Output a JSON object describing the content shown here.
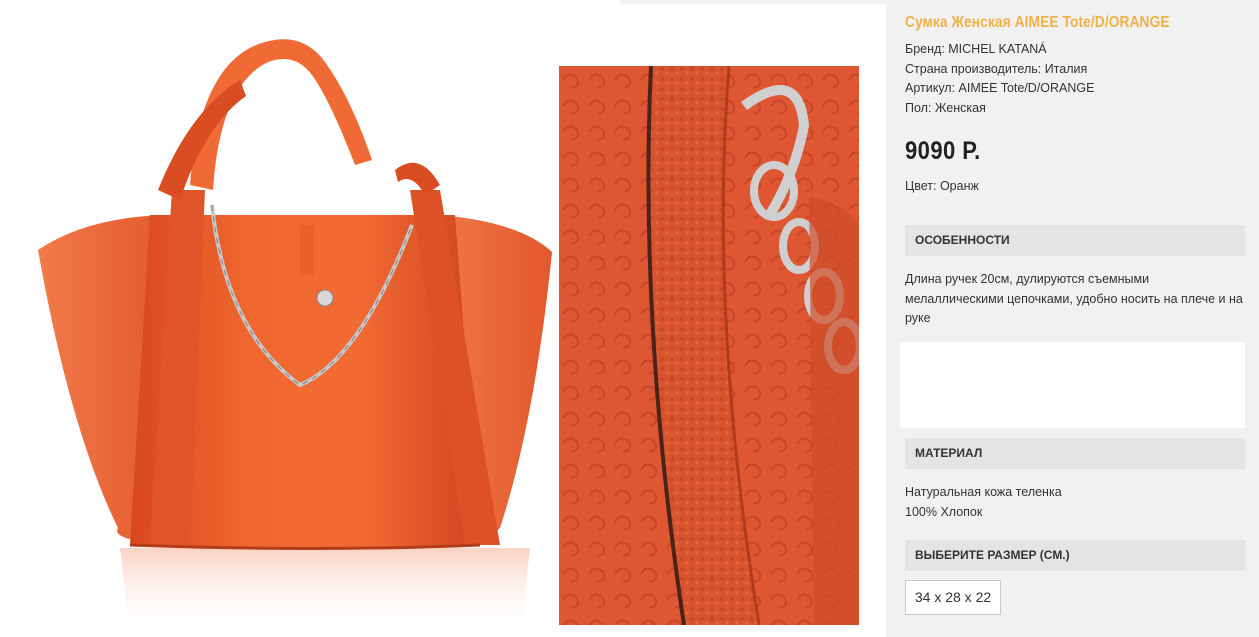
{
  "product": {
    "title": "Сумка Женская AIMEE Tote/D/ORANGE",
    "brand": "Бренд: MICHEL KATANÁ",
    "country": "Страна производитель: Италия",
    "article": "Артикул: AIMEE Tote/D/ORANGE",
    "gender": "Пол: Женская",
    "price": "9090 Р.",
    "color": "Цвет: Оранж"
  },
  "features": {
    "heading": "ОСОБЕННОСТИ",
    "text": "Длина ручек 20см, дулируются съемными мелаллическими цепочками, удобно носить на плече и на руке"
  },
  "material": {
    "heading": "МАТЕРИАЛ",
    "lines": [
      "Натуральная кожа теленка",
      "100% Хлопок"
    ]
  },
  "size": {
    "heading": "ВЫБЕРИТЕ РАЗМЕР (СМ.)",
    "options": [
      "34 x 28 x 22"
    ]
  },
  "colors": {
    "title": "#eeb247",
    "section_bg": "#e4e4e4",
    "panel_bg": "#f1f1f1",
    "bag_orange": "#e8592e"
  }
}
